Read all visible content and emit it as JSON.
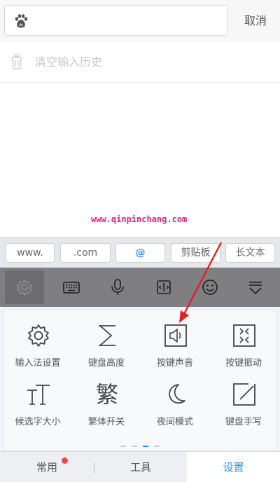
{
  "search": {
    "placeholder": "",
    "cancel_label": "取消",
    "clear_history_label": "清空输入历史"
  },
  "watermark": "www.qinpinchang.com",
  "suggestions": [
    "www.",
    ".com",
    "@",
    "剪贴板",
    "长文本"
  ],
  "toolbar": {
    "icons": [
      "gear-icon",
      "keyboard-icon",
      "microphone-icon",
      "cursor-icon",
      "emoji-icon",
      "collapse-icon"
    ]
  },
  "settings_grid": [
    {
      "label": "输入法设置",
      "icon": "gear-icon"
    },
    {
      "label": "键盘高度",
      "icon": "height-icon"
    },
    {
      "label": "按键声音",
      "icon": "speaker-icon"
    },
    {
      "label": "按键振动",
      "icon": "vibrate-icon"
    },
    {
      "label": "候选字大小",
      "icon": "font-size-icon"
    },
    {
      "label": "繁体开关",
      "icon": "traditional-icon"
    },
    {
      "label": "夜间模式",
      "icon": "moon-icon"
    },
    {
      "label": "键盘手写",
      "icon": "pen-icon"
    }
  ],
  "traditional_glyph": "繁",
  "pager": {
    "pages": 4,
    "current": 3
  },
  "tabs": [
    {
      "label": "常用",
      "badge": true
    },
    {
      "label": "工具",
      "badge": false
    },
    {
      "label": "设置",
      "badge": false,
      "selected": true
    }
  ],
  "colors": {
    "accent": "#2d8ff0",
    "toolbar": "#7f7f81",
    "badge": "#f2474b",
    "annotation": "#e02020"
  }
}
